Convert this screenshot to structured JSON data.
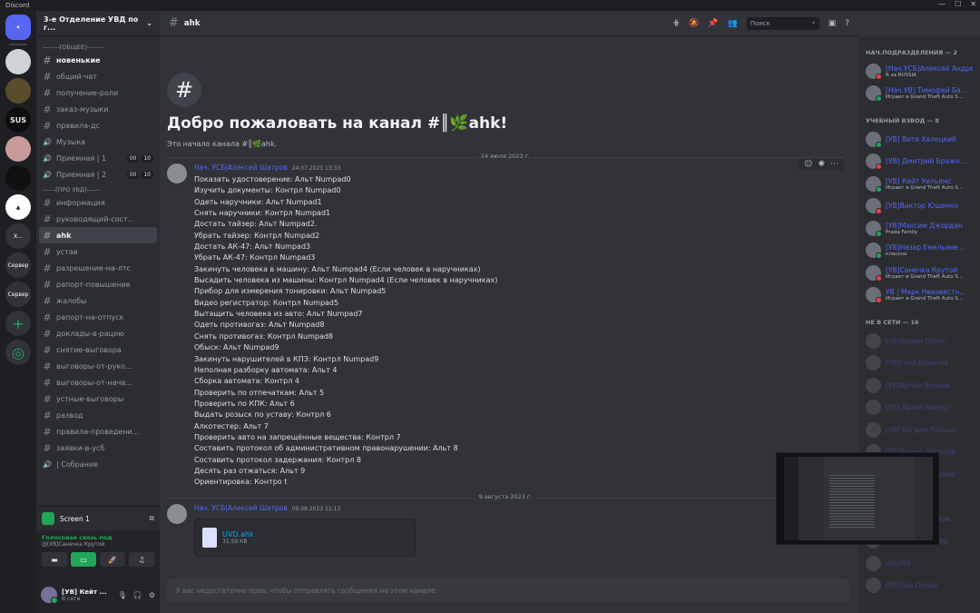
{
  "app": {
    "title": "Discord"
  },
  "server": {
    "name": "3-е Отделение УВД по г..."
  },
  "rail": {
    "srv_sus": "SUS",
    "srv_x": "X...",
    "srv_search1": "Сервер",
    "srv_search2": "Сервер"
  },
  "categories": {
    "general": "--------[ОБЩЕЕ]--------",
    "about": "------[ПРО УВД]------"
  },
  "channels": [
    {
      "name": "новенькие",
      "state": "unread"
    },
    {
      "name": "общий-чат",
      "state": "normal"
    },
    {
      "name": "получение-роли",
      "state": "normal"
    },
    {
      "name": "заказ-музыки",
      "state": "normal"
    },
    {
      "name": "правила-дс",
      "state": "normal"
    },
    {
      "name": "Музыка",
      "state": "voice"
    },
    {
      "name": "Приемная | 1",
      "state": "voice",
      "counts": [
        "00",
        "10"
      ]
    },
    {
      "name": "Приемная | 2",
      "state": "voice",
      "counts": [
        "00",
        "10"
      ]
    }
  ],
  "channels2": [
    {
      "name": "информация",
      "state": "normal"
    },
    {
      "name": "руководящий-сост...",
      "state": "normal"
    },
    {
      "name": "ahk",
      "state": "active"
    },
    {
      "name": "устав",
      "state": "normal"
    },
    {
      "name": "разрешение-на-лтс",
      "state": "normal"
    },
    {
      "name": "рапорт-повышение",
      "state": "normal"
    },
    {
      "name": "жалобы",
      "state": "normal"
    },
    {
      "name": "рапорт-на-отпуск",
      "state": "normal"
    },
    {
      "name": "доклады-в-рацию",
      "state": "normal"
    },
    {
      "name": "снятие-выговора",
      "state": "normal"
    },
    {
      "name": "выговоры-от-руко...",
      "state": "normal"
    },
    {
      "name": "выговоры-от-нача...",
      "state": "normal"
    },
    {
      "name": "устные-выговоры",
      "state": "normal"
    },
    {
      "name": "развод",
      "state": "normal"
    },
    {
      "name": "правила-проведени...",
      "state": "normal"
    },
    {
      "name": "заявки-в-усб",
      "state": "normal"
    },
    {
      "name": "| Собрание",
      "state": "voice"
    }
  ],
  "voice": {
    "screen_label": "Screen 1",
    "status": "Голосовая связь под",
    "channel": "@[УВ]Санечка Крутой"
  },
  "user": {
    "name": "[УВ] Кейт ...",
    "status": "В сети"
  },
  "topbar": {
    "channel": "ahk",
    "search_placeholder": "Поиск"
  },
  "welcome": {
    "title": "Добро пожаловать на канал #║🌿ahk!",
    "subtitle": "Это начало канала #║🌿ahk."
  },
  "date1": "24 июля 2023 г.",
  "date2": "9 августа 2023 г.",
  "message1": {
    "author": "Нач. УСБ|Алексей Шатров",
    "time": "24.07.2023 13:33",
    "lines": [
      "Показать удостоверение: Альт Numpad0",
      "Изучить документы: Контрл Numpad0",
      "Одеть наручники: Альт Numpad1",
      "Снять наручники: Контрл Numpad1",
      "Достать тайзер: Альт Numpad2.",
      "Убрать тайзер:  Контрл Numpad2",
      "Достать АК-47: Альт Numpad3",
      "Убрать АК-47: Контрл Numpad3",
      "Закинуть человека в машину: Альт Numpad4 (Если человек в наручниках)",
      "Высадить человека из машины: Контрл Numpad4 (Если человек в наручниках)",
      "Прибор для измерения тонировки: Альт Numpad5",
      "Видео регистратор:  Контрл Numpad5",
      "Вытащить человека из авто: Альт Numpad7",
      "Одеть противогаз: Альт Numpad8",
      "Снять противогаз:  Контрл Numpad8",
      "Обыск: Альт Numpad9",
      "Закинуть нарушителей в КПЗ: Контрл Numpad9",
      "Неполная разборку автомата: Альт 4",
      "Сборка автомата: Контрл 4",
      "Проверить по отпечаткам: Альт 5",
      "Проверить по КПК:  Альт 6",
      "Выдать розыск по уставу: Контрл 6",
      "Алкотестер: Альт 7",
      "Проверить авто на запрещённые вещества: Контрл 7",
      "Составить протокол об административном правонарушении: Альт 8",
      "Составить протокол задержания: Контрл 8",
      "Десять раз отжаться: Альт 9",
      "Ориентировка: Контро t"
    ]
  },
  "message2": {
    "author": "Нач. УСБ|Алексей Шатров",
    "time": "09.08.2023 11:13",
    "file_name": "UVD.ahk",
    "file_size": "31.59 КВ"
  },
  "composer": {
    "placeholder": "У вас недостаточно прав, чтобы отправлять сообщения на этом канале."
  },
  "members": {
    "groups": [
      {
        "title": "НАЧ.ПОДРАЗДЕЛЕНИЯ — 2",
        "items": [
          {
            "name": "[Нач.УСБ]Алексей Андре...",
            "activity": "R за RUSSIA",
            "status": "dnd"
          },
          {
            "name": "[Нач.УВ] Тимофей Ба...",
            "activity": "Играет в Grand Theft Auto S...",
            "status": "on"
          }
        ]
      },
      {
        "title": "УЧЕБНЫЙ ВЗВОД — 8",
        "items": [
          {
            "name": "[УВ] Витя Халецкий",
            "activity": "",
            "status": "on"
          },
          {
            "name": "[УВ] Дмитрий Бражн...",
            "activity": "",
            "status": "dnd"
          },
          {
            "name": "[УВ] Кейт Уильямс",
            "activity": "Играет в Grand Theft Auto S...",
            "status": "on"
          },
          {
            "name": "[УВ]Виктор Ющенко",
            "activity": "",
            "status": "dnd"
          },
          {
            "name": "[УВ]Максим Джордан",
            "activity": "Prada Family",
            "status": "on"
          },
          {
            "name": "[УВ]Назар Емельяне...",
            "activity": "классна",
            "status": "on"
          },
          {
            "name": "[УВ]Санечка Крутой",
            "activity": "Играет в Grand Theft Auto S...",
            "status": "dnd"
          },
          {
            "name": "УВ | Марк Неизвестн...",
            "activity": "Играет в Grand Theft Auto S...",
            "status": "dnd"
          }
        ]
      },
      {
        "title": "НЕ В СЕТИ — 16",
        "items": [
          {
            "name": "[УВ]Вадим Сотин",
            "activity": "",
            "status": "off"
          },
          {
            "name": "[УВ]Глеб Ковалёв",
            "activity": "",
            "status": "off"
          },
          {
            "name": "[УВ]Артём Волков",
            "activity": "",
            "status": "off"
          },
          {
            "name": "[УВ] Архип Баркут",
            "activity": "",
            "status": "off"
          },
          {
            "name": "[УВ] Богдан Ровный",
            "activity": "",
            "status": "off"
          },
          {
            "name": "[УВ]Вадим Денисов",
            "activity": "",
            "status": "off"
          },
          {
            "name": "[УВ]Денис Пахомов",
            "activity": "",
            "status": "off"
          },
          {
            "name": "[УВ]Егор Зотов",
            "activity": "",
            "status": "off"
          },
          {
            "name": "[УВ]Илья Морозов",
            "activity": "",
            "status": "off"
          },
          {
            "name": "[УВ]Алекс Фишер",
            "activity": "",
            "status": "off"
          },
          {
            "name": "chu999",
            "activity": "",
            "status": "off"
          },
          {
            "name": "[УВ]Лев Орлов",
            "activity": "",
            "status": "off"
          }
        ]
      }
    ]
  }
}
